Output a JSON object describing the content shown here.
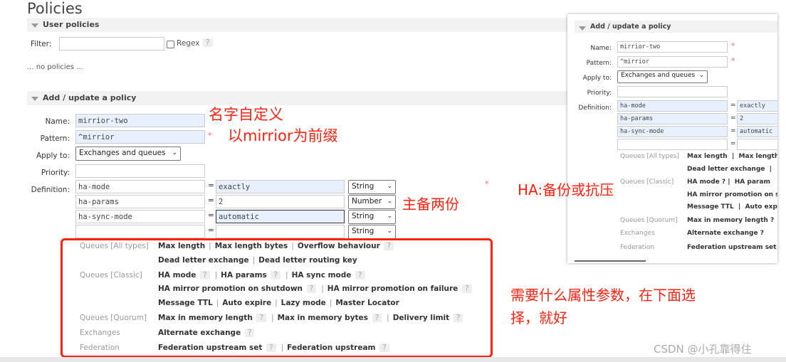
{
  "page": {
    "title": "Policies"
  },
  "user_policies": {
    "header": "User policies",
    "filter_label": "Filter:",
    "filter_value": "",
    "regex_label": "Regex",
    "help": "?",
    "empty_text": "... no policies ..."
  },
  "form": {
    "header": "Add / update a policy",
    "name_label": "Name:",
    "name_value": "mirrior-two",
    "pattern_label": "Pattern:",
    "pattern_value": "^mirrior",
    "apply_label": "Apply to:",
    "apply_value": "Exchanges and queues",
    "priority_label": "Priority:",
    "priority_value": "",
    "definition_label": "Definition:",
    "required": "*",
    "eq": "=",
    "definitions": [
      {
        "key": "ha-mode",
        "value": "exactly",
        "type": "String"
      },
      {
        "key": "ha-params",
        "value": "2",
        "type": "Number"
      },
      {
        "key": "ha-sync-mode",
        "value": "automatic",
        "type": "String"
      },
      {
        "key": "",
        "value": "",
        "type": "String"
      }
    ]
  },
  "categories": [
    {
      "label": "Queues [All types]",
      "lines": [
        [
          "Max length",
          "Max length bytes",
          "Overflow behaviour ?"
        ],
        [
          "Dead letter exchange",
          "Dead letter routing key"
        ]
      ]
    },
    {
      "label": "Queues [Classic]",
      "lines": [
        [
          "HA mode ?",
          "HA params ?",
          "HA sync mode ?"
        ],
        [
          "HA mirror promotion on shutdown ?",
          "HA mirror promotion on failure ?"
        ],
        [
          "Message TTL",
          "Auto expire",
          "Lazy mode",
          "Master Locator"
        ]
      ]
    },
    {
      "label": "Queues [Quorum]",
      "lines": [
        [
          "Max in memory length ?",
          "Max in memory bytes ?",
          "Delivery limit ?"
        ]
      ]
    },
    {
      "label": "Exchanges",
      "lines": [
        [
          "Alternate exchange ?"
        ]
      ]
    },
    {
      "label": "Federation",
      "lines": [
        [
          "Federation upstream set ?",
          "Federation upstream ?"
        ]
      ]
    }
  ],
  "annotations": {
    "name_note": "名字自定义",
    "pattern_note": "以mirrior为前缀",
    "params_note": "主备两份",
    "ha_note": "HA:备份或抗压",
    "select_note_1": "需要什么属性参数，在下面选",
    "select_note_2": "择，就好",
    "asterisk": "*"
  },
  "inset": {
    "header": "Add / update a policy",
    "name_label": "Name:",
    "name_value": "mirrior-two",
    "pattern_label": "Pattern:",
    "pattern_value": "^mirrior",
    "apply_label": "Apply to:",
    "apply_value": "Exchanges and queues",
    "priority_label": "Priority:",
    "definition_label": "Definition:",
    "definitions": [
      {
        "key": "ha-mode",
        "value": "exactly"
      },
      {
        "key": "ha-params",
        "value": "2"
      },
      {
        "key": "ha-sync-mode",
        "value": "automatic"
      },
      {
        "key": "",
        "value": ""
      }
    ],
    "rows": [
      {
        "label": "Queues [All types]",
        "text": "Max length  |  Max length"
      },
      {
        "label": "",
        "text": "Dead letter exchange  |"
      },
      {
        "label": "Queues [Classic]",
        "text": "HA mode ? |  HA param"
      },
      {
        "label": "",
        "text": "HA mirror promotion on s"
      },
      {
        "label": "",
        "text": "Message TTL  |  Auto exp"
      },
      {
        "label": "Queues [Quorum]",
        "text": "Max in memory length ?"
      },
      {
        "label": "Exchanges",
        "text": "Alternate exchange ?"
      },
      {
        "label": "Federation",
        "text": "Federation upstream set"
      }
    ]
  },
  "watermark": "CSDN @小孔靠得住",
  "colors": {
    "annotation": "#ff2211",
    "highlight": "#e8f0fe",
    "bar": "#f2f2f2"
  }
}
